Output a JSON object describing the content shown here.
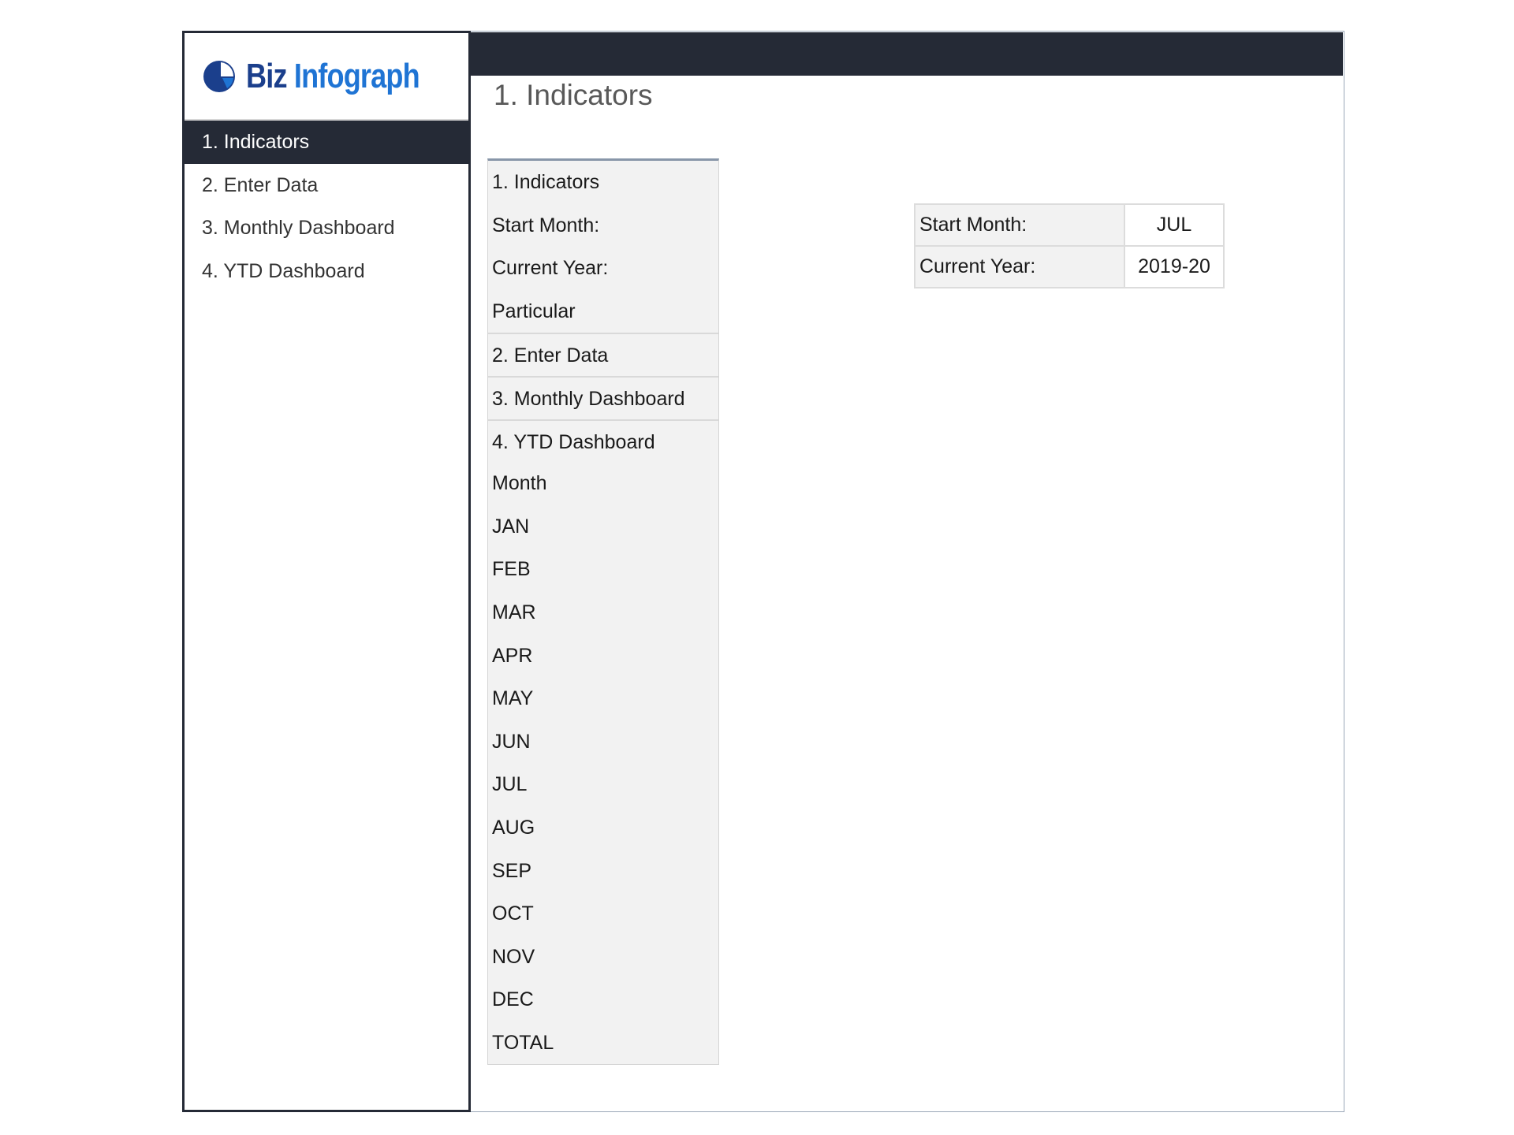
{
  "brand": {
    "name_part1": "Biz",
    "name_part2": "Infograph",
    "colors": {
      "dark_blue": "#1b3f8c",
      "light_blue": "#1f74d4",
      "navy": "#252a36"
    }
  },
  "sidebar": {
    "items": [
      {
        "label": "1. Indicators",
        "active": true
      },
      {
        "label": "2. Enter Data",
        "active": false
      },
      {
        "label": "3. Monthly Dashboard",
        "active": false
      },
      {
        "label": "4. YTD Dashboard",
        "active": false
      }
    ]
  },
  "main": {
    "title": "1. Indicators",
    "list": [
      "1. Indicators",
      "Start Month:",
      "Current Year:",
      "Particular",
      "2. Enter Data",
      "3. Monthly Dashboard",
      "4. YTD Dashboard",
      "Month",
      "JAN",
      "FEB",
      "MAR",
      "APR",
      "MAY",
      "JUN",
      "JUL",
      "AUG",
      "SEP",
      "OCT",
      "NOV",
      "DEC",
      "TOTAL"
    ],
    "settings": [
      {
        "label": "Start Month:",
        "value": "JUL"
      },
      {
        "label": "Current Year:",
        "value": "2019-20"
      }
    ]
  }
}
